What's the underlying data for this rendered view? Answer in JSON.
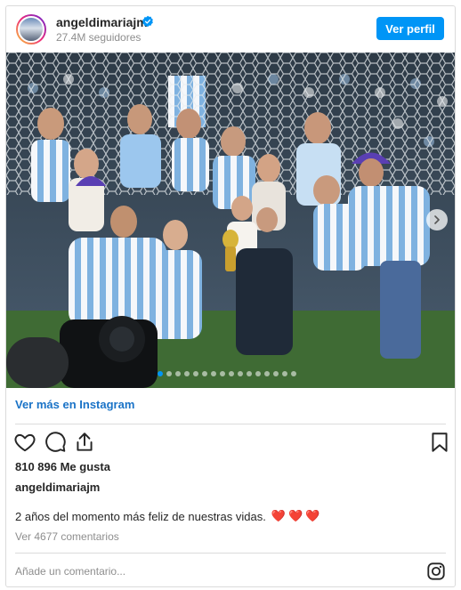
{
  "header": {
    "username": "angeldimariajm",
    "followers": "27.4M seguidores",
    "view_profile_label": "Ver perfil"
  },
  "post": {
    "image_alt": "Foto del post",
    "carousel": {
      "total": 16,
      "active_index": 0
    },
    "view_more_label": "Ver más en Instagram",
    "likes": "810 896 Me gusta",
    "caption_username": "angeldimariajm",
    "caption_text": "2 años del momento más feliz de nuestras vidas.",
    "caption_emoji": "❤️❤️❤️",
    "comments_link": "Ver 4677 comentarios",
    "add_comment_placeholder": "Añade un comentario..."
  },
  "icons": {
    "verified": "verified-badge-icon",
    "like": "heart-icon",
    "comment": "comment-icon",
    "share": "share-icon",
    "save": "bookmark-icon",
    "next": "chevron-right-icon",
    "brand": "instagram-icon"
  },
  "colors": {
    "accent": "#0095f6",
    "link": "#1a73c7",
    "heart": "#e0245e",
    "muted": "#8e8e8e",
    "border": "#dbdbdb"
  }
}
